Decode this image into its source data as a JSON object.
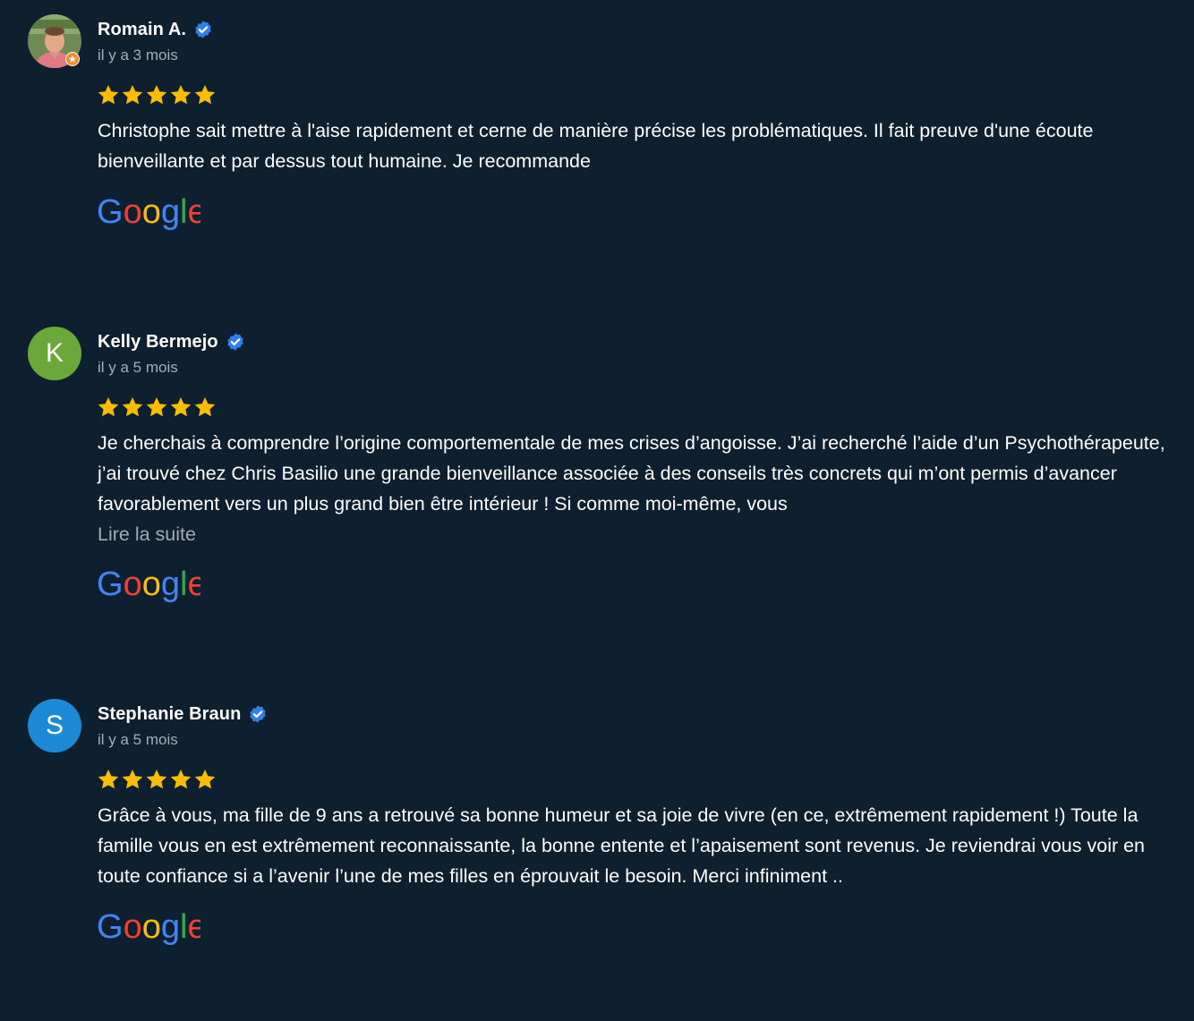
{
  "colors": {
    "background": "#0e1f30",
    "verified": "#2f80ed",
    "star": "#fbbc04",
    "muted": "#a5adb6"
  },
  "reviews": [
    {
      "name": "Romain A.",
      "date": "il y a 3 mois",
      "rating": 5,
      "avatar_type": "photo",
      "text": "Christophe sait mettre à l'aise rapidement et cerne de manière précise les problématiques. Il fait preuve d'une écoute bienveillante et par dessus tout humaine. Je recommande",
      "read_more": "",
      "source_icon": "google-logo"
    },
    {
      "name": "Kelly Bermejo",
      "date": "il y a 5 mois",
      "rating": 5,
      "avatar_type": "letter",
      "avatar_letter": "K",
      "avatar_color": "#6aa83a",
      "text": "Je cherchais à comprendre l’origine comportementale de mes crises d’angoisse. J’ai recherché l’aide d’un Psychothérapeute, j’ai trouvé chez Chris Basilio une grande bienveillance associée à des conseils très concrets qui m’ont permis d’avancer favorablement vers un plus grand bien être intérieur ! Si comme moi-même, vous",
      "read_more": "Lire la suite",
      "source_icon": "google-logo"
    },
    {
      "name": "Stephanie Braun",
      "date": "il y a 5 mois",
      "rating": 5,
      "avatar_type": "letter",
      "avatar_letter": "S",
      "avatar_color": "#1d8ad6",
      "text": "Grâce à vous, ma fille de 9 ans a retrouvé sa bonne humeur et sa joie de vivre (en ce, extrêmement rapidement !) Toute la famille vous en est extrêmement reconnaissante, la bonne entente et l’apaisement sont revenus. Je reviendrai vous voir en toute confiance si a l’avenir l’une de mes filles en éprouvait le besoin. Merci infiniment ..",
      "read_more": "",
      "source_icon": "google-logo"
    }
  ]
}
